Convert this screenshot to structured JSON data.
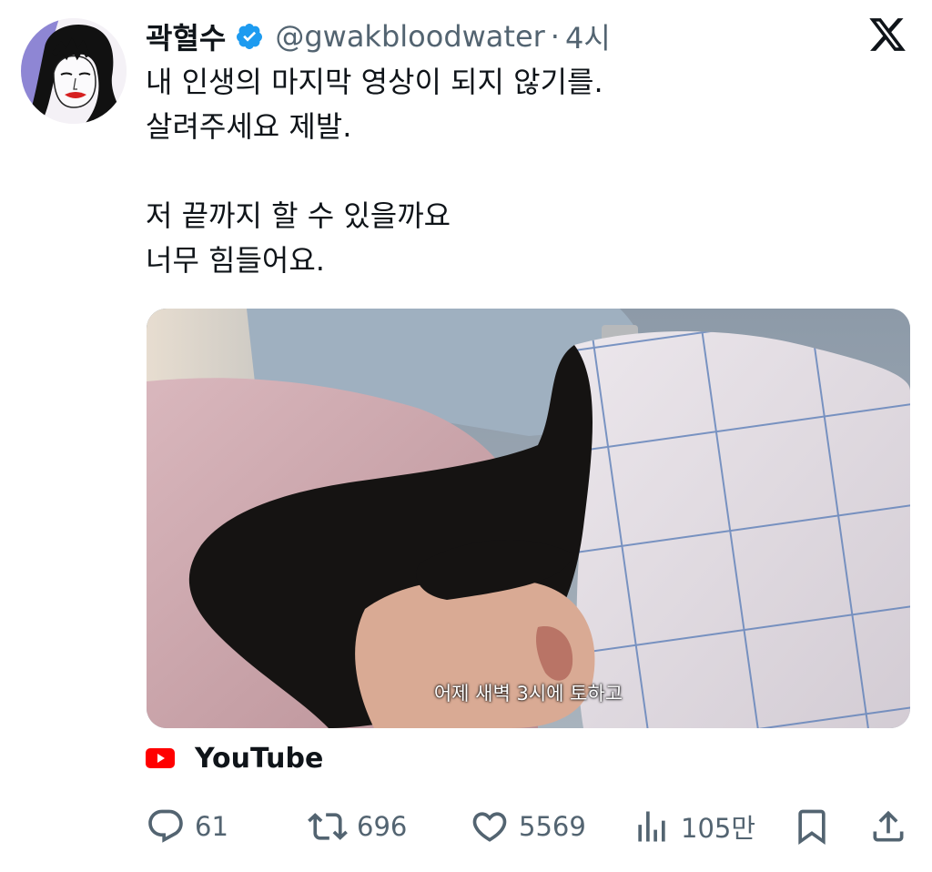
{
  "author": {
    "display_name": "곽혈수",
    "handle": "@gwakbloodwater",
    "separator": "·",
    "time": "4시",
    "avatar_icon": "avatar-illustration",
    "verified_icon": "verified-badge-icon",
    "verified_color": "#1d9bf0"
  },
  "platform_icon": "x-logo-icon",
  "tweet": {
    "lines": [
      "내 인생의 마지막 영상이 되지 않기를.",
      "살려주세요 제발.",
      "",
      "저 끝까지 할 수 있을까요",
      "너무 힘들어요."
    ]
  },
  "media": {
    "subtitle": "어제 새벽 3시에 토하고"
  },
  "source": {
    "label": "YouTube",
    "icon": "youtube-icon",
    "icon_color": "#ff0000"
  },
  "actions": {
    "reply": {
      "icon": "reply-icon",
      "count": "61"
    },
    "retweet": {
      "icon": "retweet-icon",
      "count": "696"
    },
    "like": {
      "icon": "heart-icon",
      "count": "5569"
    },
    "views": {
      "icon": "views-icon",
      "count": "105만"
    },
    "bookmark": {
      "icon": "bookmark-icon"
    },
    "share": {
      "icon": "share-icon"
    }
  },
  "colors": {
    "text": "#0f1419",
    "secondary": "#536471"
  }
}
